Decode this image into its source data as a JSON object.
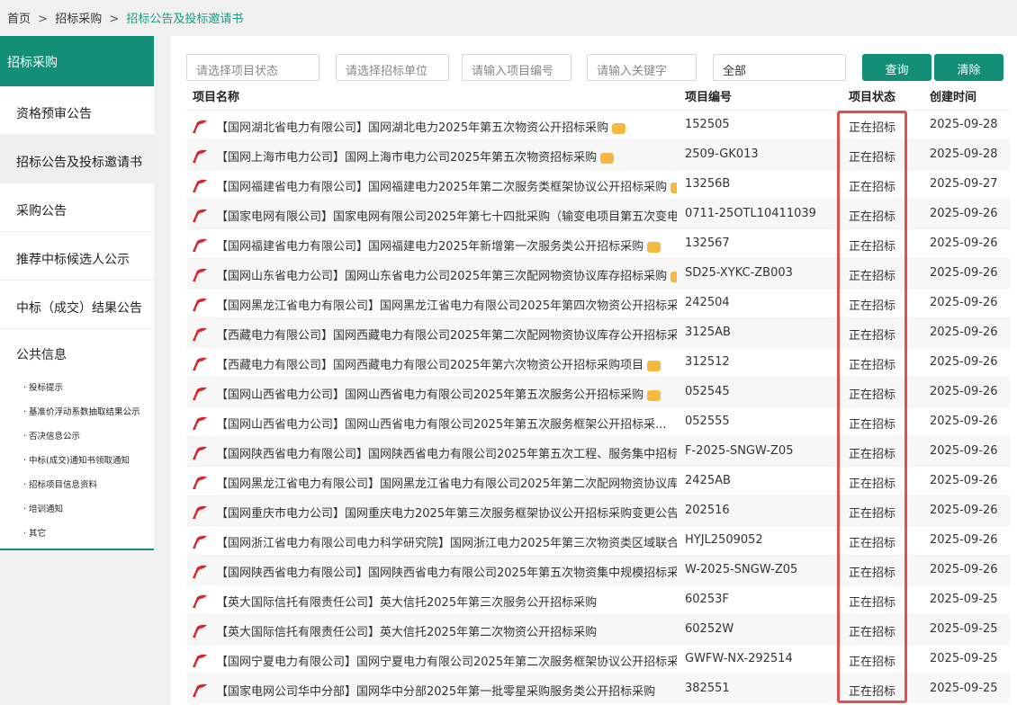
{
  "breadcrumb": {
    "home": "首页",
    "sep1": ">",
    "level2": "招标采购",
    "sep2": ">",
    "current": "招标公告及投标邀请书"
  },
  "sidebar": {
    "header": "招标采购",
    "items": [
      {
        "label": "资格预审公告"
      },
      {
        "label": "招标公告及投标邀请书"
      },
      {
        "label": "采购公告"
      },
      {
        "label": "推荐中标候选人公示"
      },
      {
        "label": "中标（成交）结果公告"
      }
    ],
    "public_info": "公共信息",
    "sub_items": [
      {
        "label": "投标提示"
      },
      {
        "label": "基准价浮动系数抽取结果公示"
      },
      {
        "label": "否决信息公示"
      },
      {
        "label": "中标(成交)通知书领取通知"
      },
      {
        "label": "招标项目信息资料"
      },
      {
        "label": "培训通知"
      },
      {
        "label": "其它"
      }
    ]
  },
  "filters": {
    "status_placeholder": "请选择项目状态",
    "unit_placeholder": "请选择招标单位",
    "code_placeholder": "请输入项目编号",
    "keyword_placeholder": "请输入关键字",
    "scope_value": "全部",
    "query_label": "查询",
    "clear_label": "清除"
  },
  "table": {
    "headers": {
      "name": "项目名称",
      "code": "项目编号",
      "status": "项目状态",
      "date": "创建时间"
    },
    "rows": [
      {
        "title": "【国网湖北省电力有限公司】国网湖北电力2025年第五次物资公开招标采购",
        "badge": true,
        "code": "152505",
        "status": "正在招标",
        "date": "2025-09-28"
      },
      {
        "title": "【国网上海市电力公司】国网上海市电力公司2025年第五次物资招标采购",
        "badge": true,
        "code": "2509-GK013",
        "status": "正在招标",
        "date": "2025-09-28"
      },
      {
        "title": "【国网福建省电力有限公司】国网福建电力2025年第二次服务类框架协议公开招标采购",
        "badge": true,
        "code": "13256B",
        "status": "正在招标",
        "date": "2025-09-27"
      },
      {
        "title": "【国家电网有限公司】国家电网有限公司2025年第七十四批采购（输变电项目第五次变电...",
        "badge": false,
        "code": "0711-25OTL10411039",
        "status": "正在招标",
        "date": "2025-09-26"
      },
      {
        "title": "【国网福建省电力有限公司】国网福建电力2025年新增第一次服务类公开招标采购",
        "badge": true,
        "code": "132567",
        "status": "正在招标",
        "date": "2025-09-26"
      },
      {
        "title": "【国网山东省电力公司】国网山东省电力公司2025年第三次配网物资协议库存招标采购",
        "badge": true,
        "code": "SD25-XYKC-ZB003",
        "status": "正在招标",
        "date": "2025-09-26"
      },
      {
        "title": "【国网黑龙江省电力有限公司】国网黑龙江省电力有限公司2025年第四次物资公开招标采...",
        "badge": false,
        "code": "242504",
        "status": "正在招标",
        "date": "2025-09-26"
      },
      {
        "title": "【西藏电力有限公司】国网西藏电力有限公司2025年第二次配网物资协议库存公开招标采...",
        "badge": false,
        "code": "3125AB",
        "status": "正在招标",
        "date": "2025-09-26"
      },
      {
        "title": "【西藏电力有限公司】国网西藏电力有限公司2025年第六次物资公开招标采购项目",
        "badge": true,
        "code": "312512",
        "status": "正在招标",
        "date": "2025-09-26"
      },
      {
        "title": "【国网山西省电力公司】国网山西省电力有限公司2025年第五次服务公开招标采购",
        "badge": true,
        "code": "052545",
        "status": "正在招标",
        "date": "2025-09-26"
      },
      {
        "title": "【国网山西省电力公司】国网山西省电力有限公司2025年第五次服务框架公开招标采...",
        "badge": false,
        "code": "052555",
        "status": "正在招标",
        "date": "2025-09-26"
      },
      {
        "title": "【国网陕西省电力有限公司】国网陕西省电力有限公司2025年第五次工程、服务集中招标...",
        "badge": false,
        "code": "F-2025-SNGW-Z05",
        "status": "正在招标",
        "date": "2025-09-26"
      },
      {
        "title": "【国网黑龙江省电力有限公司】国网黑龙江省电力有限公司2025年第二次配网物资协议库...",
        "badge": false,
        "code": "2425AB",
        "status": "正在招标",
        "date": "2025-09-26"
      },
      {
        "title": "【国网重庆市电力公司】国网重庆电力2025年第三次服务框架协议公开招标采购变更公告...",
        "badge": false,
        "code": "202516",
        "status": "正在招标",
        "date": "2025-09-26"
      },
      {
        "title": "【国网浙江省电力有限公司电力科学研究院】国网浙江电力2025年第三次物资类区域联合...",
        "badge": false,
        "code": "HYJL2509052",
        "status": "正在招标",
        "date": "2025-09-26"
      },
      {
        "title": "【国网陕西省电力有限公司】国网陕西省电力有限公司2025年第五次物资集中规模招标采...",
        "badge": false,
        "code": "W-2025-SNGW-Z05",
        "status": "正在招标",
        "date": "2025-09-26"
      },
      {
        "title": "【英大国际信托有限责任公司】英大信托2025年第三次服务公开招标采购",
        "badge": false,
        "code": "60253F",
        "status": "正在招标",
        "date": "2025-09-25"
      },
      {
        "title": "【英大国际信托有限责任公司】英大信托2025年第二次物资公开招标采购",
        "badge": false,
        "code": "60252W",
        "status": "正在招标",
        "date": "2025-09-25"
      },
      {
        "title": "【国网宁夏电力有限公司】国网宁夏电力有限公司2025年第二次服务框架协议公开招标采...",
        "badge": false,
        "code": "GWFW-NX-292514",
        "status": "正在招标",
        "date": "2025-09-25"
      },
      {
        "title": "【国家电网公司华中分部】国网华中分部2025年第一批零星采购服务类公开招标采购",
        "badge": false,
        "code": "382551",
        "status": "正在招标",
        "date": "2025-09-25"
      }
    ]
  },
  "colors": {
    "brand": "#148f77",
    "highlight_box": "#e0504f",
    "flag": "#d9262c",
    "new_badge": "#f5b942"
  },
  "icons": {
    "row_flag": "red-flag-icon",
    "new_badge": "new-badge-icon"
  }
}
